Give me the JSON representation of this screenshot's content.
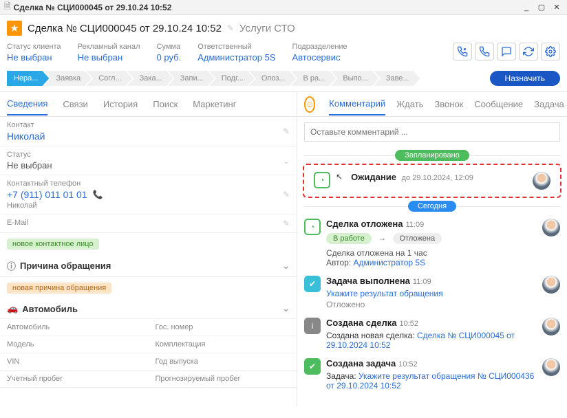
{
  "window": {
    "title": "Сделка № СЦИ000045 от 29.10.24 10:52"
  },
  "header": {
    "title": "Сделка № СЦИ000045 от 29.10.24 10:52",
    "service": "Услуги СТО"
  },
  "summary": {
    "client_status_label": "Статус клиента",
    "client_status_value": "Не выбран",
    "channel_label": "Рекламный канал",
    "channel_value": "Не выбран",
    "sum_label": "Сумма",
    "sum_value": "0 руб.",
    "responsible_label": "Ответственный",
    "responsible_value": "Администратор 5S",
    "division_label": "Подразделение",
    "division_value": "Автосервис"
  },
  "stages": [
    "Нера...",
    "Заявка",
    "Согл...",
    "Зака...",
    "Запи...",
    "Подг...",
    "Опоз...",
    "В ра...",
    "Выпо...",
    "Заве..."
  ],
  "assign_label": "Назначить",
  "tabs_left": {
    "t0": "Сведения",
    "t1": "Связи",
    "t2": "История",
    "t3": "Поиск",
    "t4": "Маркетинг"
  },
  "left": {
    "contact_label": "Контакт",
    "contact_value": "Николай",
    "status_label": "Статус",
    "status_value": "Не выбран",
    "phone_label": "Контактный телефон",
    "phone_value": "+7 (911) 011 01 01",
    "phone_owner": "Николай",
    "email_label": "E-Mail",
    "tag_new_contact": "новое контактное лицо",
    "reason_header": "Причина обращения",
    "tag_new_reason": "новая причина обращения",
    "car_header": "Автомобиль",
    "cols": {
      "car": "Автомобиль",
      "gos": "Гос. номер",
      "model": "Модель",
      "kompl": "Комплектация",
      "vin": "VIN",
      "year": "Год выпуска",
      "recorded": "Учетный пробег",
      "predicted": "Прогнозируемый пробег"
    }
  },
  "tabs_right": {
    "t0": "Комментарий",
    "t1": "Ждать",
    "t2": "Звонок",
    "t3": "Сообщение",
    "t4": "Задача"
  },
  "comment_placeholder": "Оставьте комментарий ...",
  "pills": {
    "planned": "Запланировано",
    "today": "Сегодня"
  },
  "events": {
    "waiting_title": "Ожидание",
    "waiting_until": "до 29.10.2024, 12:09",
    "postponed_title": "Сделка отложена",
    "postponed_time": "11:09",
    "chip_work": "В работе",
    "chip_postponed": "Отложена",
    "postponed_text": "Сделка отложена на 1 час",
    "author_label": "Автор:",
    "author_name": "Администратор 5S",
    "task_done_title": "Задача выполнена",
    "task_done_time": "11:09",
    "task_done_link": "Укажите результат обращения",
    "task_done_status": "Отложено",
    "deal_created_title": "Создана сделка",
    "deal_created_time": "10:52",
    "deal_created_text": "Создана новая сделка:",
    "deal_created_link": "Сделка № СЦИ000045 от 29.10.2024 10:52",
    "task_created_title": "Создана задача",
    "task_created_time": "10:52",
    "task_created_text": "Задача:",
    "task_created_link": "Укажите результат обращения № СЦИ000436 от 29.10.2024 10:52"
  }
}
